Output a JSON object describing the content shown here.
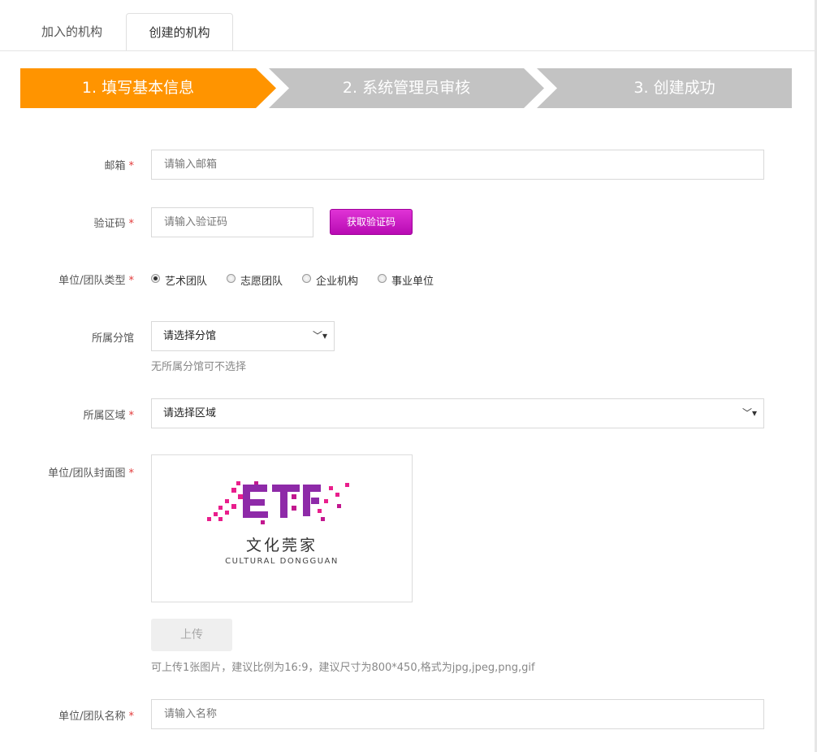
{
  "tabs": [
    {
      "label": "加入的机构",
      "active": false
    },
    {
      "label": "创建的机构",
      "active": true
    }
  ],
  "steps": [
    {
      "label": "1. 填写基本信息",
      "active": true
    },
    {
      "label": "2. 系统管理员审核",
      "active": false
    },
    {
      "label": "3. 创建成功",
      "active": false
    }
  ],
  "colors": {
    "step_active": "#ff9400",
    "step_inactive": "#c3c3c3",
    "required": "#e23a3a",
    "code_button": "#cc1cc6"
  },
  "form": {
    "required_mark": "*",
    "email": {
      "label": "邮箱",
      "placeholder": "请输入邮箱",
      "value": ""
    },
    "code": {
      "label": "验证码",
      "placeholder": "请输入验证码",
      "value": "",
      "button": "获取验证码"
    },
    "type": {
      "label": "单位/团队类型",
      "options": [
        "艺术团队",
        "志愿团队",
        "企业机构",
        "事业单位"
      ],
      "selected": "艺术团队"
    },
    "branch": {
      "label": "所属分馆",
      "selected": "请选择分馆",
      "hint": "无所属分馆可不选择"
    },
    "area": {
      "label": "所属区域",
      "selected": "请选择区域"
    },
    "cover": {
      "label": "单位/团队封面图",
      "logo_cn": "文化莞家",
      "logo_en": "CULTURAL DONGGUAN",
      "upload_button": "上传",
      "hint": "可上传1张图片，建议比例为16:9，建议尺寸为800*450,格式为jpg,jpeg,png,gif"
    },
    "name": {
      "label": "单位/团队名称",
      "placeholder": "请输入名称",
      "value": ""
    }
  }
}
